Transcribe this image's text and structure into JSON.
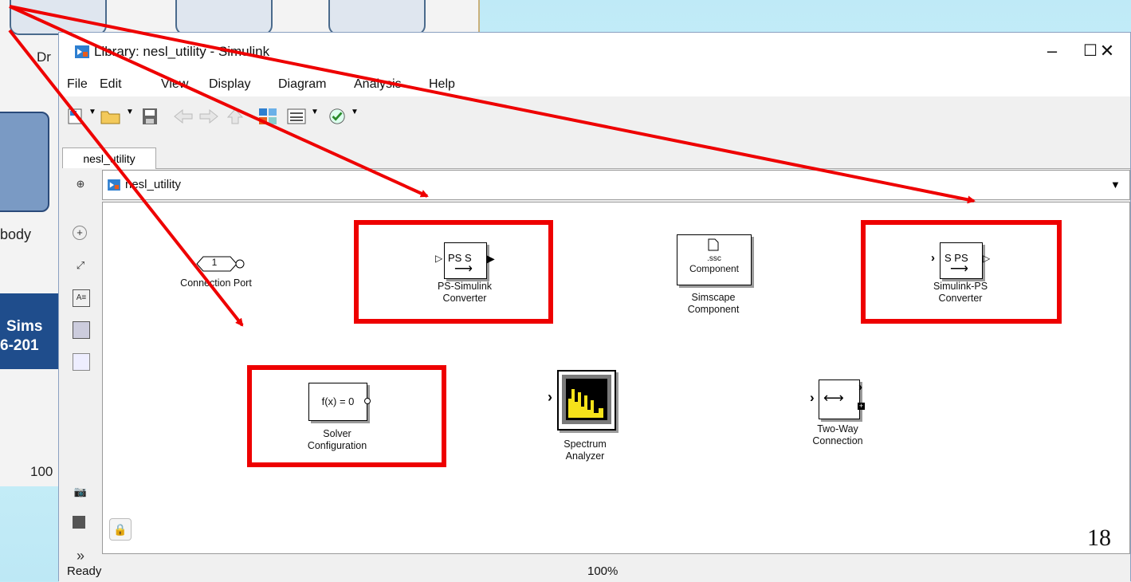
{
  "background_window": {
    "fragment_dr": "Dr",
    "fragment_body": "body",
    "sidebar_line1": "Sims",
    "sidebar_line2": "6-201",
    "zoom_fragment": "100"
  },
  "window": {
    "title": "Library: nesl_utility - Simulink",
    "controls": {
      "minimize": "–",
      "maximize": "☐",
      "close": "✕"
    },
    "menu": [
      "File",
      "Edit",
      "View",
      "Display",
      "Diagram",
      "Analysis",
      "Help"
    ],
    "tab_label": "nesl_utility",
    "breadcrumb": "nesl_utility",
    "status": {
      "left": "Ready",
      "zoom": "100%"
    }
  },
  "blocks": {
    "connection_port": {
      "port_number": "1",
      "label": "Connection Port"
    },
    "ps_simulink": {
      "icon_text": "PS S",
      "label_line1": "PS-Simulink",
      "label_line2": "Converter"
    },
    "simscape_component": {
      "icon_line1": ".ssc",
      "icon_line2": "Component",
      "label_line1": "Simscape",
      "label_line2": "Component"
    },
    "simulink_ps": {
      "icon_text": "S PS",
      "label_line1": "Simulink-PS",
      "label_line2": "Converter"
    },
    "solver_config": {
      "icon_text": "f(x) = 0",
      "label_line1": "Solver",
      "label_line2": "Configuration"
    },
    "spectrum_analyzer": {
      "label_line1": "Spectrum",
      "label_line2": "Analyzer"
    },
    "two_way": {
      "label_line1": "Two-Way",
      "label_line2": "Connection"
    }
  },
  "highlight_color": "#ee0000",
  "slide_number": "18"
}
